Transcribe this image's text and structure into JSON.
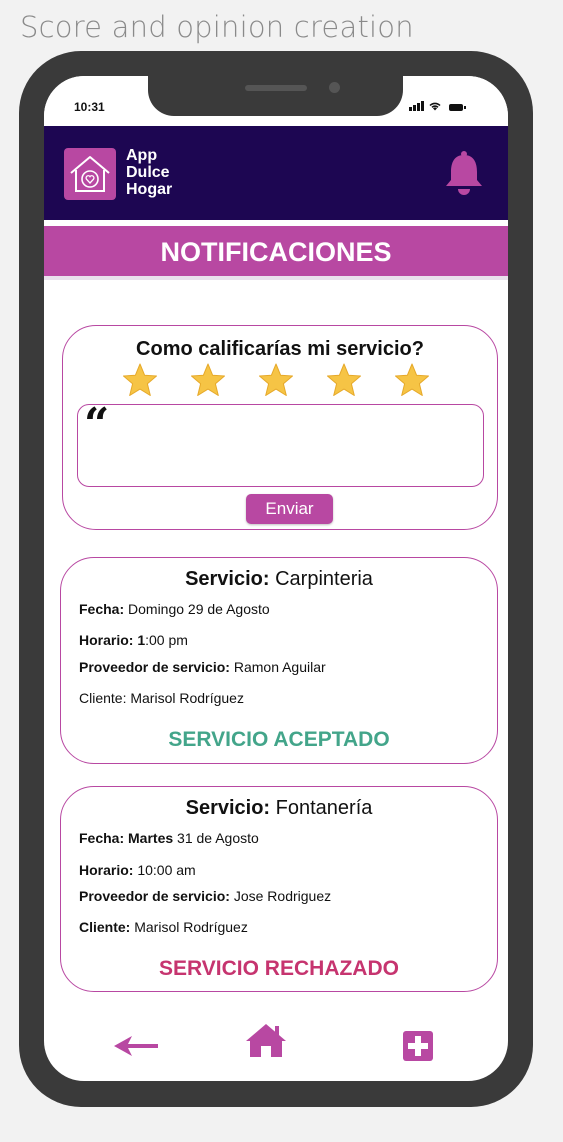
{
  "frame_caption": "Score and opinion creation",
  "status_bar": {
    "time": "10:31"
  },
  "header": {
    "brand_line1": "App",
    "brand_line2": "Dulce",
    "brand_line3": "Hogar",
    "title": "NOTIFICACIONES"
  },
  "rating": {
    "question": "Como calificarías  mi servicio?",
    "stars": 5,
    "quote_glyph": "“",
    "comment_value": "",
    "send_label": "Enviar"
  },
  "services": [
    {
      "title_label": "Servicio:",
      "title_value": " Carpinteria",
      "fecha_label": "Fecha:",
      "fecha_value": " Domingo 29 de Agosto",
      "horario_label": "Horario: 1",
      "horario_value": ":00 pm",
      "proveedor_label": "Proveedor de servicio:",
      "proveedor_value": " Ramon Aguilar",
      "cliente_label": "",
      "cliente_value": "Cliente: Marisol Rodríguez",
      "status": "SERVICIO ACEPTADO",
      "status_color": "#43a58a"
    },
    {
      "title_label": "Servicio:",
      "title_value": " Fontanería",
      "fecha_label": "Fecha: Martes",
      "fecha_value": " 31 de Agosto",
      "horario_label": "Horario:",
      "horario_value": " 10:00 am",
      "proveedor_label": "Proveedor de servicio:",
      "proveedor_value": " Jose Rodriguez",
      "cliente_label": "Cliente:",
      "cliente_value": " Marisol Rodríguez",
      "status": "SERVICIO RECHAZADO",
      "status_color": "#c6346f"
    }
  ],
  "colors": {
    "accent": "#b848a2",
    "header_bg": "#1d0652",
    "star": "#f6c445"
  },
  "bottom_nav": {
    "back_icon": "arrow-left-icon",
    "home_icon": "home-icon",
    "add_icon": "plus-square-icon"
  }
}
